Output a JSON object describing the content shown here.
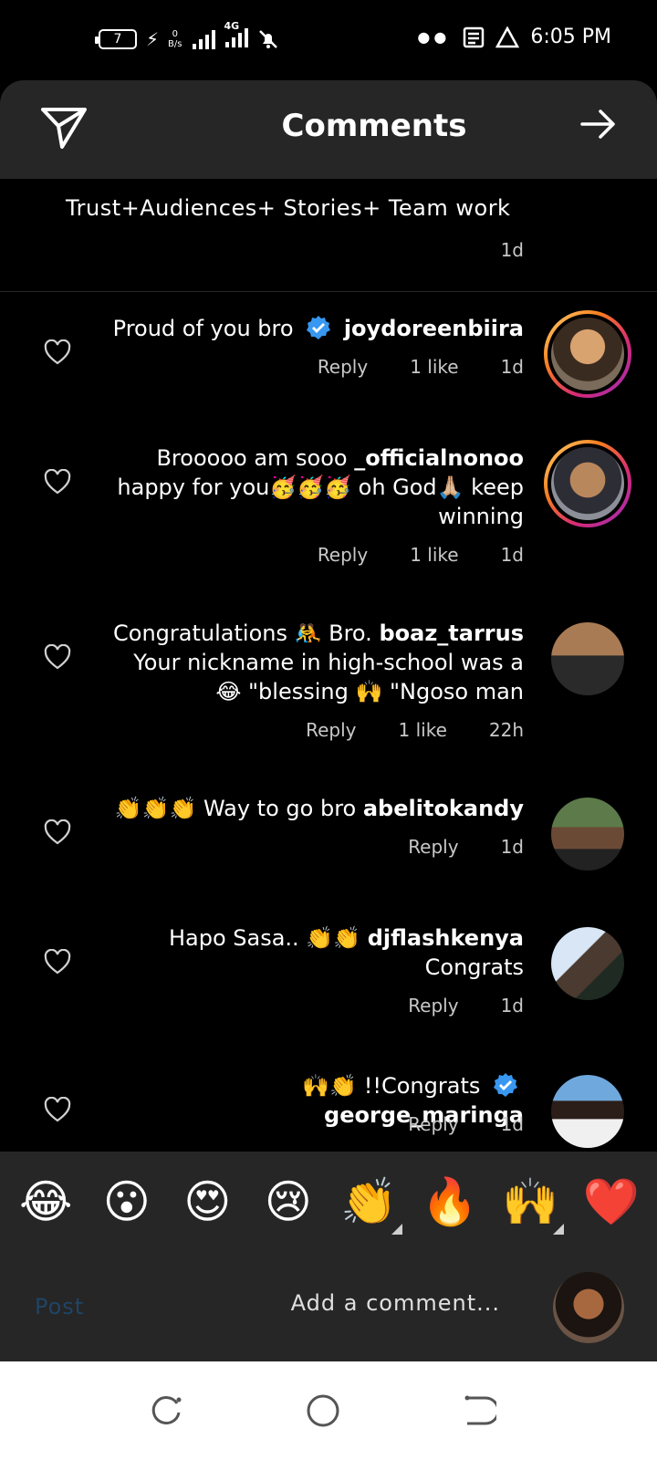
{
  "status_bar": {
    "battery": "7",
    "net_speed_top": "0",
    "net_speed_bottom": "B/s",
    "network": "4G",
    "time": "6:05 PM"
  },
  "header": {
    "title": "Comments"
  },
  "caption": {
    "text": "Trust+Audiences+  Stories+ Team work",
    "time": "1d"
  },
  "comments": [
    {
      "text": "Proud of you bro",
      "username": "joydoreenbiira",
      "verified": true,
      "reply": "Reply",
      "likes": "1 like",
      "time": "1d"
    },
    {
      "text": "Brooooo am sooo",
      "username": "_officialnonoo",
      "text2": "happy for you🥳🥳🥳 oh God🙏🏼 keep winning",
      "reply": "Reply",
      "likes": "1 like",
      "time": "1d"
    },
    {
      "text": "Congratulations 🤼 Bro.",
      "username": "boaz_tarrus",
      "text2": "Your nickname in high-school was a 😂 \"blessing 🙌 \"Ngoso man",
      "reply": "Reply",
      "likes": "1 like",
      "time": "22h"
    },
    {
      "text": "👏👏👏 Way to go bro",
      "username": "abelitokandy",
      "reply": "Reply",
      "time": "1d"
    },
    {
      "text": "Hapo Sasa.. 👏👏",
      "username": "djflashkenya",
      "text2": "Congrats",
      "reply": "Reply",
      "time": "1d"
    },
    {
      "text": "🙌👏 !!Congrats",
      "username": "george_maringa",
      "verified": true,
      "reply": "Reply",
      "time": "1d"
    }
  ],
  "emoji_bar": [
    "😂",
    "😮",
    "😍",
    "😢",
    "👏",
    "🔥",
    "🙌",
    "❤️"
  ],
  "compose": {
    "post_label": "Post",
    "placeholder": "Add a comment..."
  },
  "colors": {
    "background": "#000000",
    "panel": "#262626",
    "verified": "#3897f0",
    "post_disabled": "#1f4566"
  }
}
